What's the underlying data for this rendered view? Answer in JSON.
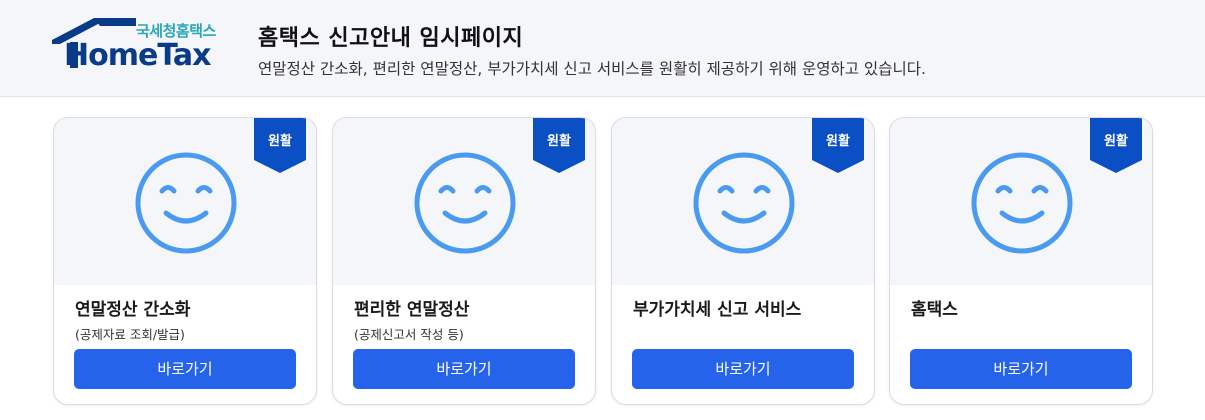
{
  "logo": {
    "sub": "국세청홈택스",
    "main": "HomeTax"
  },
  "header": {
    "title": "홈택스 신고안내 임시페이지",
    "subtitle": "연말정산 간소화, 편리한 연말정산, 부가가치세 신고 서비스를 원활히 제공하기 위해 운영하고 있습니다."
  },
  "colors": {
    "accent": "#2563eb",
    "ribbon": "#0b4fc4",
    "smile": "#4a9af0",
    "logo": "#0a3b88"
  },
  "cards": [
    {
      "status": "원활",
      "title": "연말정산 간소화",
      "desc": "(공제자료 조회/발급)",
      "button": "바로가기",
      "icon": "smile-icon"
    },
    {
      "status": "원활",
      "title": "편리한 연말정산",
      "desc": "(공제신고서 작성 등)",
      "button": "바로가기",
      "icon": "smile-icon"
    },
    {
      "status": "원활",
      "title": "부가가치세 신고 서비스",
      "desc": "",
      "button": "바로가기",
      "icon": "smile-icon"
    },
    {
      "status": "원활",
      "title": "홈택스",
      "desc": "",
      "button": "바로가기",
      "icon": "smile-icon"
    }
  ]
}
